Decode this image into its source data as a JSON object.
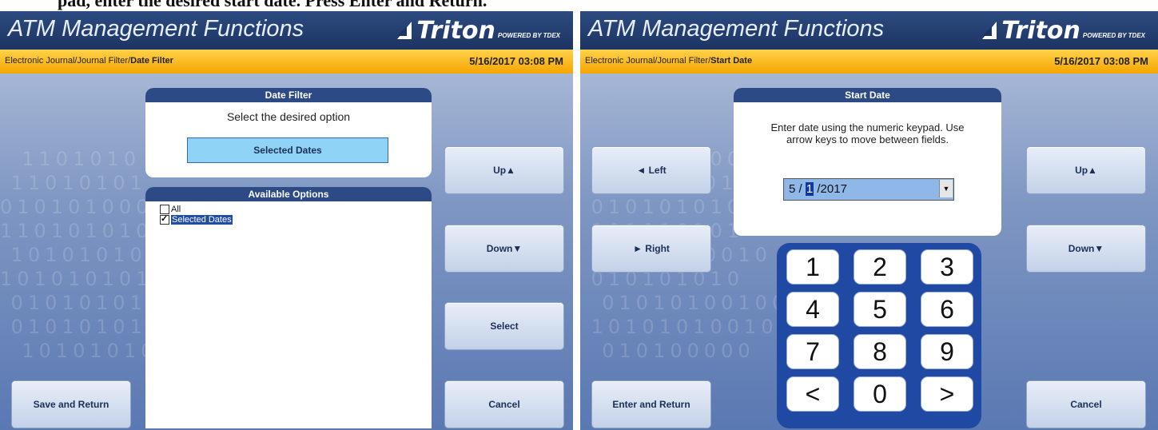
{
  "doc_caption": "pad, enter the desired start date. Press Enter and Return.",
  "left_screen": {
    "title": "ATM Management Functions",
    "logo": {
      "brand": "Triton",
      "powered": "POWERED BY TDEX"
    },
    "breadcrumb_path": "Electronic Journal/Journal Filter/",
    "breadcrumb_current": "Date Filter",
    "datetime": "5/16/2017  03:08 PM",
    "panel_title": "Date Filter",
    "panel_prompt": "Select the desired option",
    "selected_value": "Selected Dates",
    "options_title": "Available Options",
    "options": [
      {
        "label": "All",
        "checked": false
      },
      {
        "label": "Selected Dates",
        "checked": true
      }
    ],
    "buttons": {
      "up": "Up▲",
      "down": "Down▼",
      "select": "Select",
      "save_return": "Save and Return",
      "cancel": "Cancel"
    }
  },
  "right_screen": {
    "title": "ATM Management Functions",
    "logo": {
      "brand": "Triton",
      "powered": "POWERED BY TDEX"
    },
    "breadcrumb_path": "Electronic Journal/Journal Filter/",
    "breadcrumb_current": "Start Date",
    "datetime": "5/16/2017  03:08 PM",
    "panel_title": "Start Date",
    "panel_prompt_line1": "Enter date using the numeric keypad.  Use",
    "panel_prompt_line2": "arrow keys to move between fields.",
    "date_month": "5 / ",
    "date_day": "1",
    "date_year": " /2017",
    "buttons": {
      "left": "◄ Left",
      "right": "► Right",
      "up": "Up▲",
      "down": "Down▼",
      "enter_return": "Enter and Return",
      "cancel": "Cancel"
    },
    "keypad": [
      "1",
      "2",
      "3",
      "4",
      "5",
      "6",
      "7",
      "8",
      "9",
      "<",
      "0",
      ">"
    ]
  },
  "colors": {
    "title_bar": "#1c3462",
    "crumb_bar": "#f5a500",
    "panel_header": "#2c4a86",
    "keypad": "#1f49a2",
    "selected_option": "#8fd3f6"
  }
}
